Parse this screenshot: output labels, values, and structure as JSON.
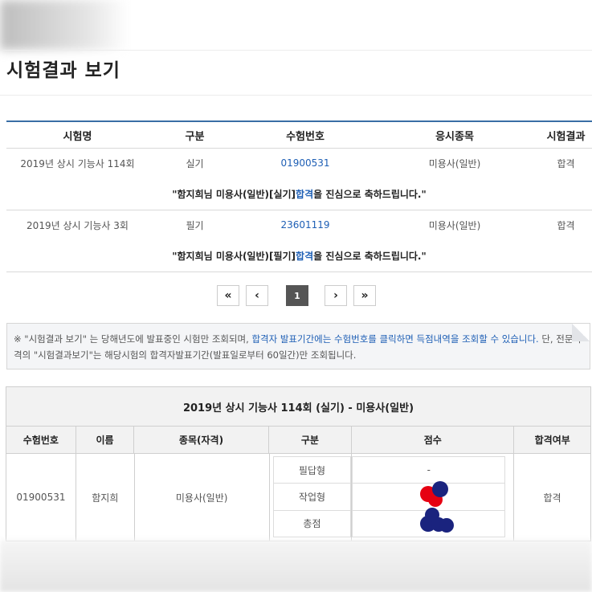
{
  "page": {
    "title": "시험결과 보기"
  },
  "results_table": {
    "headers": [
      "시험명",
      "구분",
      "수험번호",
      "응시종목",
      "시험결과"
    ],
    "rows": [
      {
        "exam": "2019년 상시 기능사 114회",
        "type": "실기",
        "number": "01900531",
        "subject": "미용사(일반)",
        "result": "합격",
        "congrats_pre": "\"함지희님 미용사(일반)[실기] ",
        "congrats_pass": "합격",
        "congrats_post": "을 진심으로 축하드립니다.\""
      },
      {
        "exam": "2019년 상시 기능사 3회",
        "type": "필기",
        "number": "23601119",
        "subject": "미용사(일반)",
        "result": "합격",
        "congrats_pre": "\"함지희님 미용사(일반)[필기] ",
        "congrats_pass": "합격",
        "congrats_post": "을 진심으로 축하드립니다.\""
      }
    ]
  },
  "pagination": {
    "first": "«",
    "prev": "‹",
    "current": "1",
    "next": "›",
    "last": "»"
  },
  "notice": {
    "part1": "※ \"시험결과 보기\" 는 당해년도에 발표중인 시험만 조회되며, ",
    "highlight": "합격자 발표기간에는 수험번호를 클릭하면 득점내역을 조회할 수 있습니다.",
    "part2": " 단, 전문자격의 \"시험결과보기\"는 해당시험의 합격자발표기간(발표일로부터 60일간)만 조회됩니다."
  },
  "detail": {
    "title": "2019년 상시 기능사 114회 (실기) - 미용사(일반)",
    "headers": [
      "수험번호",
      "이름",
      "종목(자격)",
      "구분",
      "점수",
      "합격여부"
    ],
    "number": "01900531",
    "name": "함지희",
    "subject": "미용사(일반)",
    "sub_rows": [
      {
        "label": "필답형",
        "score": "-"
      },
      {
        "label": "작업형",
        "score": ""
      },
      {
        "label": "총점",
        "score": ""
      }
    ],
    "result": "합격"
  },
  "colors": {
    "accent": "#1e5fb5",
    "table_border": "#3a6ea5",
    "redact_red": "#e60012",
    "redact_navy": "#1a237e"
  }
}
